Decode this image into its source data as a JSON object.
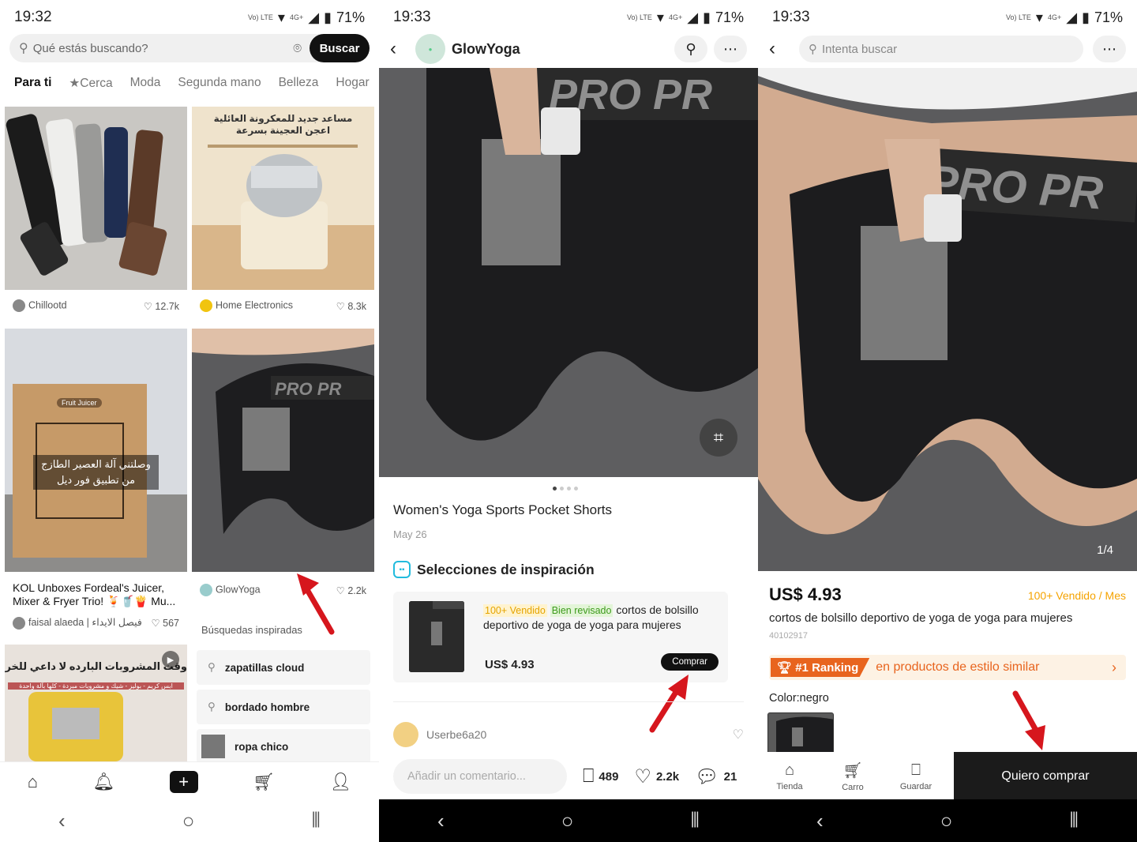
{
  "screen1": {
    "status": {
      "time": "19:32",
      "battery": "71%",
      "net": "Vo) LTE",
      "gen": "4G+"
    },
    "search": {
      "placeholder": "Qué estás buscando?",
      "button": "Buscar"
    },
    "tabs": [
      "Para ti",
      "★Cerca",
      "Moda",
      "Segunda mano",
      "Belleza",
      "Hogar"
    ],
    "cards": [
      {
        "author": "Chillootd",
        "likes": "12.7k"
      },
      {
        "author": "Home Electronics",
        "likes": "8.3k",
        "overlay": "مساعد جديد للمعكرونة العائلية اعجن العجينة بسرعة"
      },
      {
        "title": "KOL Unboxes Fordeal's Juicer, Mixer & Fryer Trio! 🍹🥤🍟 Mu...",
        "author": "faisal alaeda | فيصل الايداء",
        "likes": "567",
        "overlay": "وصلتني آلة العصير الطازج من تطبيق فور ديل",
        "box_label": "Fruit Juicer"
      },
      {
        "author": "GlowYoga",
        "likes": "2.2k"
      },
      {
        "overlay": "وقت المشروبات البارده لا داعي للخروج",
        "sub": "ابس كريم - بوليز - شيك و مشروبات مبردة - كلها بآلة واحدة"
      }
    ],
    "searches_head": "Búsquedas inspiradas",
    "searches": [
      "zapatillas cloud",
      "bordado hombre",
      "ropa chico"
    ]
  },
  "screen2": {
    "status": {
      "time": "19:33",
      "battery": "71%",
      "net": "Vo) LTE",
      "gen": "4G+"
    },
    "shop": "GlowYoga",
    "title": "Women's Yoga Sports Pocket Shorts",
    "date": "May 26",
    "section": "Selecciones de inspiración",
    "product": {
      "tag1": "100+ Vendido",
      "tag2": "Bien revisado",
      "desc": "cortos de bolsillo deportivo de yoga de yoga para mujeres",
      "price": "US$ 4.93",
      "button": "Comprar"
    },
    "commenter": "Userbe6a20",
    "comment_placeholder": "Añadir un comentario...",
    "saves": "489",
    "likes": "2.2k",
    "comments": "21"
  },
  "screen3": {
    "status": {
      "time": "19:33",
      "battery": "71%",
      "net": "Vo) LTE",
      "gen": "4G+"
    },
    "search_placeholder": "Intenta buscar",
    "counter": "1/4",
    "price": "US$ 4.93",
    "sold": "100+ Vendido / Mes",
    "title": "cortos de bolsillo deportivo de yoga de yoga para mujeres",
    "code": "40102917",
    "ranking": "#1 Ranking",
    "ranking_text": "en productos de estilo similar",
    "color_label": "Color:negro",
    "actions": [
      "Tienda",
      "Carro",
      "Guardar"
    ],
    "buy": "Quiero comprar"
  },
  "colors": {
    "accent_orange": "#e8641e",
    "sold_yellow": "#f5a300",
    "dark": "#111111",
    "arrow_red": "#d6161d"
  }
}
